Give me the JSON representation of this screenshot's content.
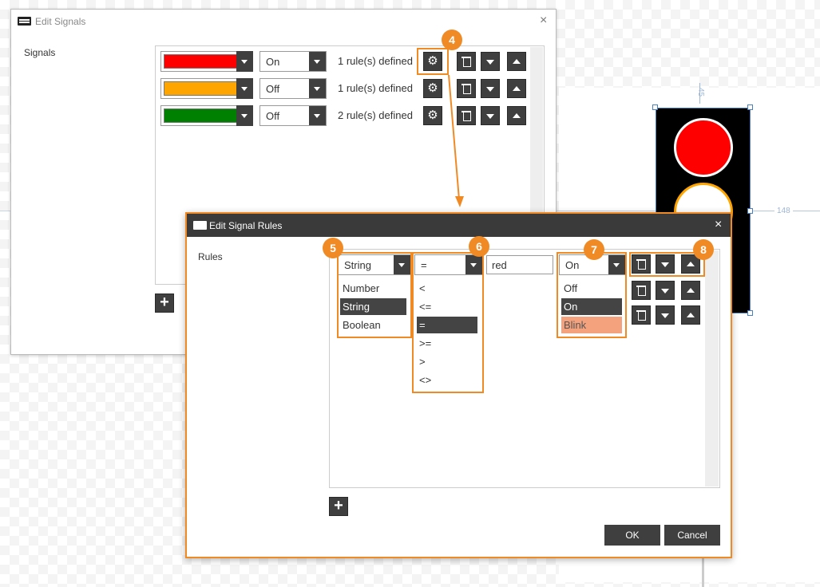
{
  "edit_signals": {
    "title": "Edit Signals",
    "close": "×",
    "label": "Signals",
    "rows": [
      {
        "color": "#ff0000",
        "state": "On",
        "rules": "1 rule(s) defined"
      },
      {
        "color": "#ffa500",
        "state": "Off",
        "rules": "1 rule(s) defined"
      },
      {
        "color": "#008000",
        "state": "Off",
        "rules": "2 rule(s) defined"
      }
    ],
    "add_label": "+"
  },
  "edit_rules": {
    "title": "Edit Signal Rules",
    "close": "×",
    "label": "Rules",
    "type_value": "String",
    "type_options": [
      "Number",
      "String",
      "Boolean"
    ],
    "type_selected": "String",
    "op_value": "=",
    "op_options": [
      "<",
      "<=",
      "=",
      ">=",
      ">",
      "<>"
    ],
    "op_selected": "=",
    "text_value": "red",
    "state_value": "On",
    "state_options": [
      "Off",
      "On",
      "Blink"
    ],
    "state_selected": "On",
    "add_label": "+",
    "ok_label": "OK",
    "cancel_label": "Cancel"
  },
  "callouts": {
    "n4": "4",
    "n5": "5",
    "n6": "6",
    "n7": "7",
    "n8": "8"
  },
  "canvas": {
    "dim_top": "45",
    "dim_right": "148"
  },
  "colors": {
    "accent": "#f08a24",
    "dark": "#3f3f3f",
    "blink": "#f4a27d",
    "traffic_red": "#ff0000"
  },
  "icons": [
    "gear-icon",
    "trash-icon",
    "arrow-down-icon",
    "arrow-up-icon",
    "plus-icon",
    "close-icon",
    "app-logo-icon"
  ]
}
